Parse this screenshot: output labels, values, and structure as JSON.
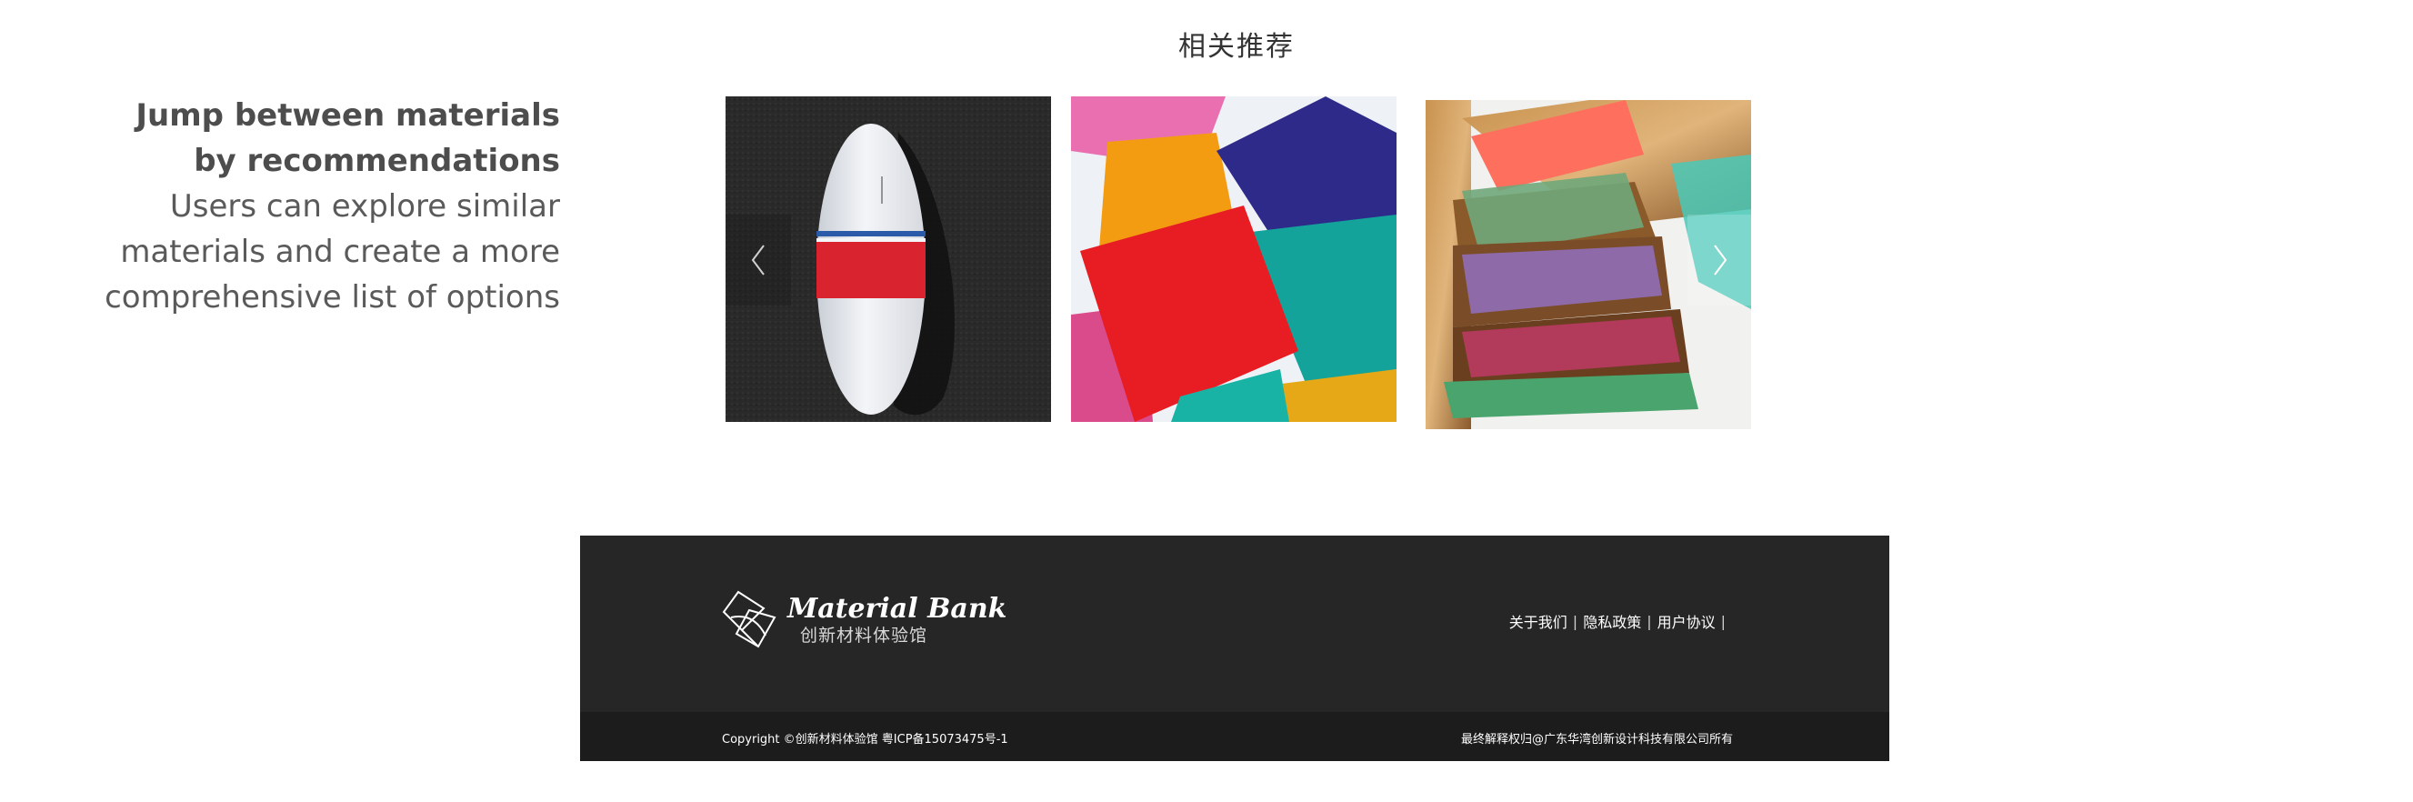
{
  "caption": {
    "title": "Jump between materials by recommendations",
    "description": "Users can explore similar materials and create a more comprehensive list of options"
  },
  "section": {
    "title": "相关推荐"
  },
  "carousel": {
    "prev_icon": "chevron-left-icon",
    "next_icon": "chevron-right-icon",
    "items": [
      {
        "image": "surfboard-on-asphalt"
      },
      {
        "image": "colored-acrylic-sheets"
      },
      {
        "image": "wood-resin-slabs"
      }
    ]
  },
  "footer": {
    "logo": {
      "name": "Material Bank",
      "subtitle": "创新材料体验馆"
    },
    "links": [
      "关于我们",
      "隐私政策",
      "用户协议"
    ],
    "copyright": "Copyright ©创新材料体验馆 粤ICP备15073475号-1",
    "rights": "最终解释权归@广东华湾创新设计科技有限公司所有",
    "background": "#262626",
    "bottom_background": "#1c1c1c"
  }
}
